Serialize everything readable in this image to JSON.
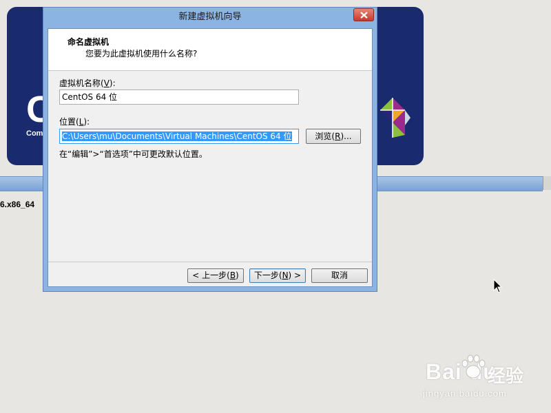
{
  "background": {
    "logo_letter": "C",
    "logo_subtext": "Com",
    "package_text": "6.x86_64",
    "accent_color": "#1a2a6e"
  },
  "watermark": {
    "brand": "Bai  du",
    "brand_cn": "经验",
    "url": "jingyan.baidu.com"
  },
  "dialog": {
    "title": "新建虚拟机向导",
    "header_title": "命名虚拟机",
    "header_subtitle": "您要为此虚拟机使用什么名称?",
    "name_label": "虚拟机名称(",
    "name_label_key": "V",
    "name_label_end": "):",
    "name_value": "CentOS 64 位",
    "location_label": "位置(",
    "location_label_key": "L",
    "location_label_end": "):",
    "location_value": "C:\\Users\\mu\\Documents\\Virtual Machines\\CentOS 64 位",
    "browse_label_pre": "浏览(",
    "browse_label_key": "R",
    "browse_label_post": ")...",
    "hint_text": "在“编辑”>“首选项”中可更改默认位置。",
    "back_pre": "< 上一步(",
    "back_key": "B",
    "back_post": ")",
    "next_pre": "下一步(",
    "next_key": "N",
    "next_post": ") >",
    "cancel_label": "取消"
  },
  "icons": {
    "close": "close-icon",
    "cursor": "mouse-pointer-icon",
    "centos": "centos-logo-icon"
  }
}
